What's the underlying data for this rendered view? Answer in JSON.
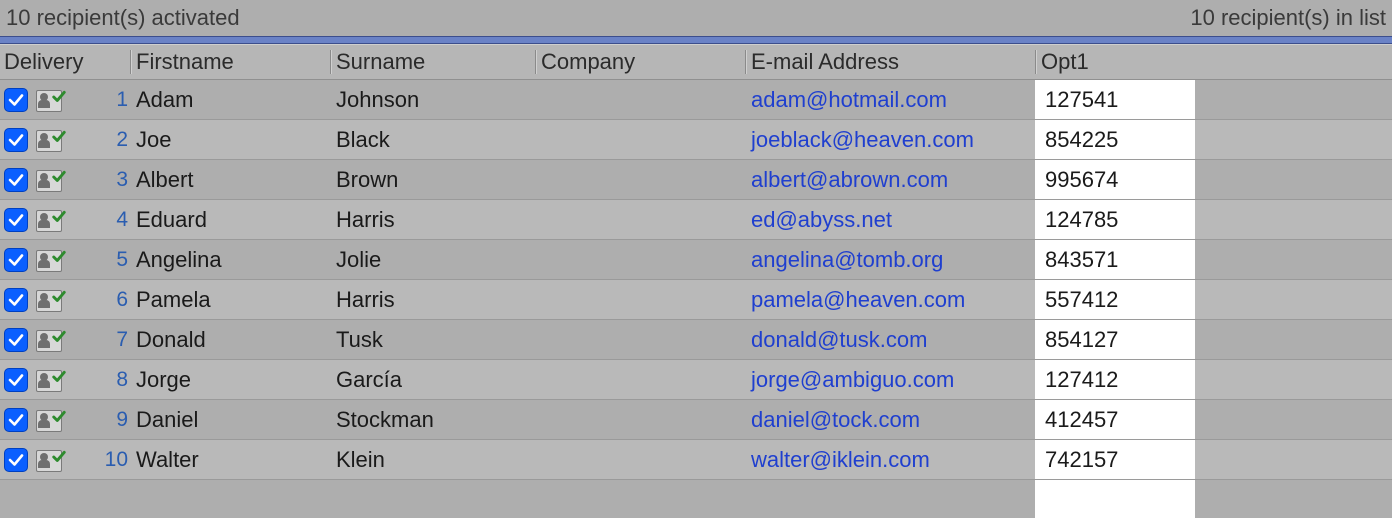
{
  "status": {
    "activated": "10 recipient(s) activated",
    "inlist": "10 recipient(s) in list"
  },
  "headers": {
    "delivery": "Delivery",
    "firstname": "Firstname",
    "surname": "Surname",
    "company": "Company",
    "email": "E-mail Address",
    "opt1": "Opt1"
  },
  "rows": [
    {
      "n": "1",
      "checked": true,
      "firstname": "Adam",
      "surname": "Johnson",
      "company": "",
      "email": "adam@hotmail.com",
      "opt1": "127541"
    },
    {
      "n": "2",
      "checked": true,
      "firstname": "Joe",
      "surname": "Black",
      "company": "",
      "email": "joeblack@heaven.com",
      "opt1": "854225"
    },
    {
      "n": "3",
      "checked": true,
      "firstname": "Albert",
      "surname": "Brown",
      "company": "",
      "email": "albert@abrown.com",
      "opt1": "995674"
    },
    {
      "n": "4",
      "checked": true,
      "firstname": "Eduard",
      "surname": "Harris",
      "company": "",
      "email": "ed@abyss.net",
      "opt1": "124785"
    },
    {
      "n": "5",
      "checked": true,
      "firstname": "Angelina",
      "surname": "Jolie",
      "company": "",
      "email": "angelina@tomb.org",
      "opt1": "843571"
    },
    {
      "n": "6",
      "checked": true,
      "firstname": "Pamela",
      "surname": "Harris",
      "company": "",
      "email": "pamela@heaven.com",
      "opt1": "557412"
    },
    {
      "n": "7",
      "checked": true,
      "firstname": "Donald",
      "surname": "Tusk",
      "company": "",
      "email": "donald@tusk.com",
      "opt1": "854127"
    },
    {
      "n": "8",
      "checked": true,
      "firstname": "Jorge",
      "surname": "García",
      "company": "",
      "email": "jorge@ambiguo.com",
      "opt1": "127412"
    },
    {
      "n": "9",
      "checked": true,
      "firstname": "Daniel",
      "surname": "Stockman",
      "company": "",
      "email": "daniel@tock.com",
      "opt1": "412457"
    },
    {
      "n": "10",
      "checked": true,
      "firstname": "Walter",
      "surname": "Klein",
      "company": "",
      "email": "walter@iklein.com",
      "opt1": "742157"
    }
  ]
}
